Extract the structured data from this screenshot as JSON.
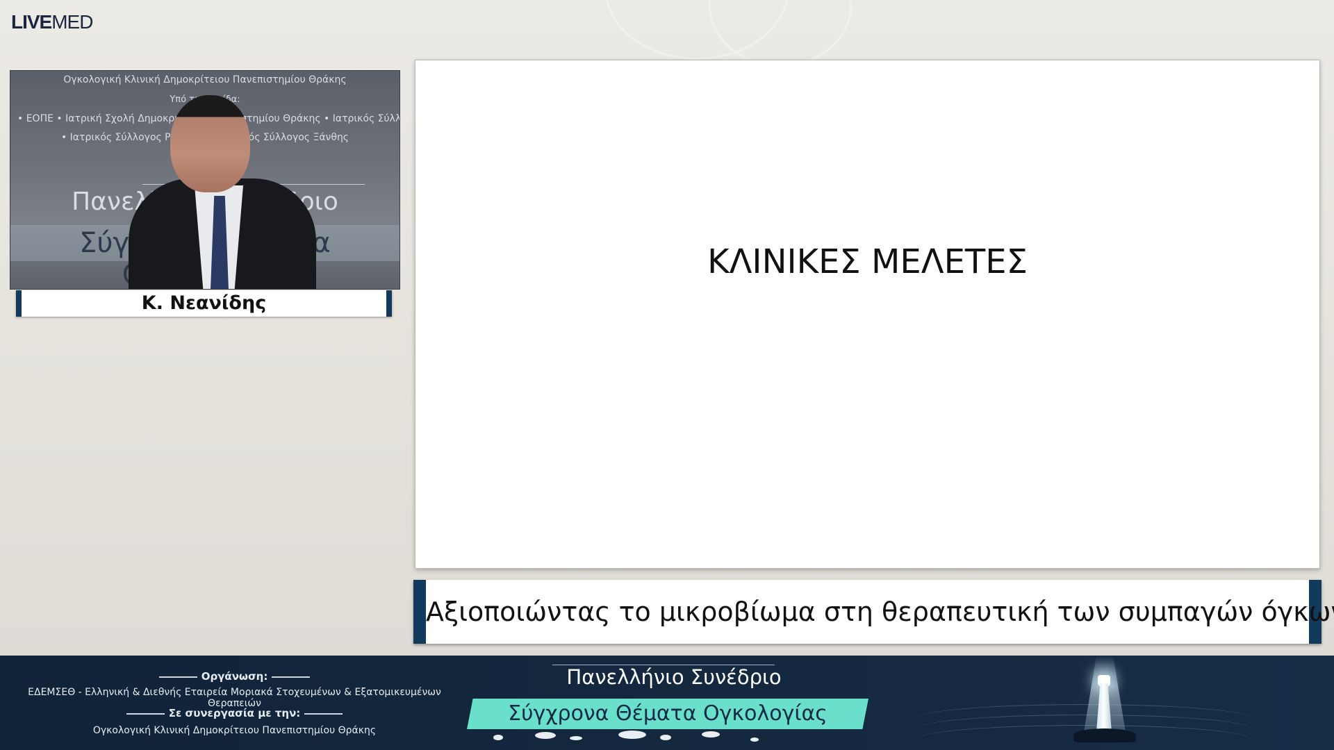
{
  "app": {
    "logo_live": "LIVE",
    "logo_med": "MED"
  },
  "video": {
    "backdrop_line1": "Ογκολογική Κλινική Δημοκρίτειου Πανεπιστημίου Θράκης",
    "backdrop_line2": "Υπό την αιγίδα:",
    "backdrop_line3": "• ΕΟΠΕ • Ιατρική Σχολή Δημοκριτείου Πανεπιστημίου Θράκης • Ιατρικός Σύλλογος",
    "backdrop_line4": "• Ιατρικός Σύλλογος Ροδόπης • Ιατρικός Σύλλογος Ξάνθης",
    "backdrop_line5": "Πανελλήνιο Συνέδριο",
    "backdrop_line6": "Σύγχρονα Θέματα Ογκολογίας"
  },
  "speaker": {
    "name": "Κ. Νεανίδης"
  },
  "slide": {
    "title": "ΚΛΙΝΙΚΕΣ ΜΕΛΕΤΕΣ"
  },
  "topic": {
    "title": "Αξιοποιώντας το μικροβίωμα στη θεραπευτική των συμπαγών όγκων"
  },
  "footer": {
    "organization_label": "Οργάνωση:",
    "organization_text": "ΕΔΕΜΣΕΘ - Ελληνική & Διεθνής Εταιρεία Μοριακά Στοχευμένων & Εξατομικευμένων Θεραπειών",
    "collaboration_label": "Σε συνεργασία με την:",
    "collaboration_text": "Ογκολογική Κλινική Δημοκρίτειου Πανεπιστημίου Θράκης",
    "conference_line1": "Πανελλήνιο Συνέδριο",
    "conference_line2": "Σύγχρονα Θέματα Ογκολογίας"
  },
  "colors": {
    "navy": "#123a5c",
    "footer_bg": "#102338",
    "accent_teal": "#6ae0cc"
  },
  "icons": {
    "footer_graphic": "lighthouse-icon"
  }
}
